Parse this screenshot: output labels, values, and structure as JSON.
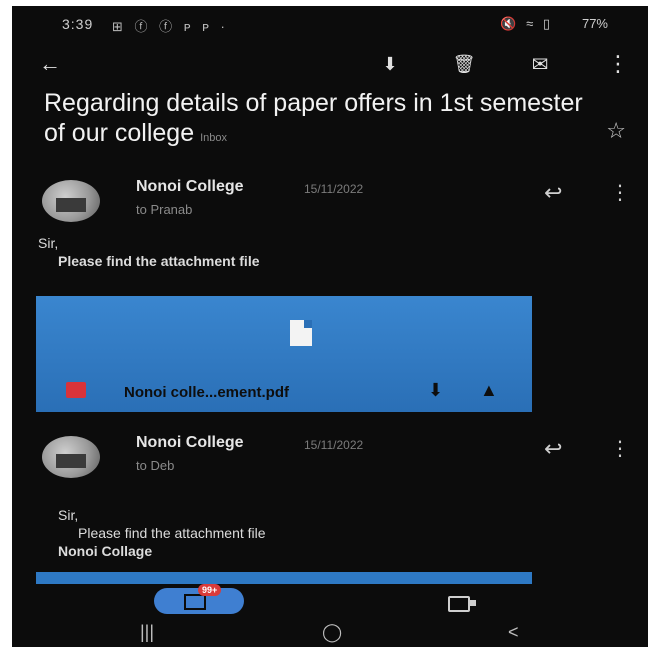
{
  "status": {
    "time": "3:39",
    "left_icons": "⊞ ⓕ ⓕ ᴘ ᴘ ·",
    "right_icons": "🔇 ≈ ▯",
    "battery": "77%"
  },
  "toolbar": {
    "back": "←",
    "archive": "⬇",
    "delete": "🗑",
    "mail": "✉",
    "more": "⋮"
  },
  "email": {
    "subject": "Regarding details of paper offers in 1st semester of our college",
    "label": "Inbox",
    "messages": [
      {
        "sender": "Nonoi College",
        "date": "15/11/2022",
        "to": "to Pranab",
        "greeting": "Sir,",
        "body": "Please find the attachment file",
        "attachment_name": "Nonoi colle...ement.pdf"
      },
      {
        "sender": "Nonoi College",
        "date": "15/11/2022",
        "to": "to Deb",
        "greeting": "Sir,",
        "body": "Please find the attachment file",
        "signature": "Nonoi Collage"
      }
    ]
  },
  "bottom_nav": {
    "mail_badge": "99+"
  },
  "system_nav": {
    "recents": "|||",
    "home": "◯",
    "back": "<"
  }
}
